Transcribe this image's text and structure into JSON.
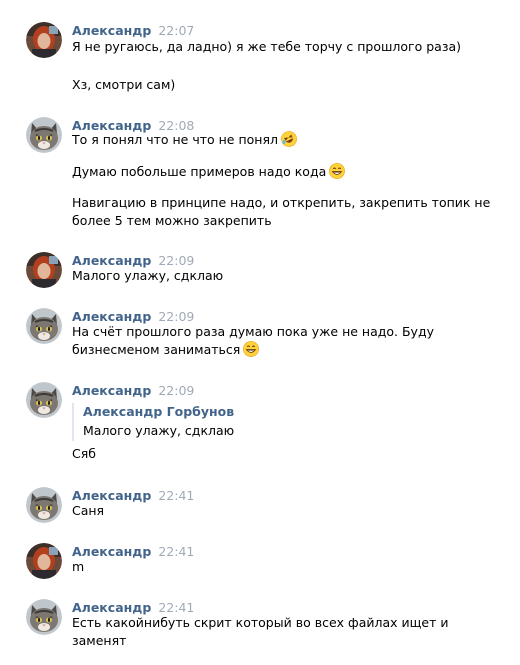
{
  "colors": {
    "author": "#42648b",
    "time": "#a0aab7",
    "quote_bar": "#dfe6ed"
  },
  "messages": [
    {
      "author": "Александр",
      "time": "22:07",
      "avatar": "red-hair-person-avatar",
      "lines": [
        "Я не ругаюсь, да ладно) я же тебе торчу с прошлого раза)",
        "Хз, смотри сам)"
      ]
    },
    {
      "author": "Александр",
      "time": "22:08",
      "avatar": "cat-avatar",
      "lines": [
        "То я понял что не что не понял",
        "Думаю побольше примеров надо кода",
        "Навигацию в принципе надо, и открепить, закрепить топик не",
        "более 5 тем можно закрепить"
      ],
      "emojis": [
        "rofl-emoji",
        "grin-emoji"
      ]
    },
    {
      "author": "Александр",
      "time": "22:09",
      "avatar": "red-hair-person-avatar",
      "lines": [
        "Малого улажу, сдклаю"
      ]
    },
    {
      "author": "Александр",
      "time": "22:09",
      "avatar": "cat-avatar",
      "lines": [
        "На счёт прошлого раза думаю пока уже не надо. Буду",
        "бизнесменом заниматься"
      ],
      "emojis": [
        "grin-emoji"
      ]
    },
    {
      "author": "Александр",
      "time": "22:09",
      "avatar": "cat-avatar",
      "quote": {
        "author": "Александр Горбунов",
        "text": "Малого улажу, сдклаю"
      },
      "lines": [
        "Сяб"
      ]
    },
    {
      "author": "Александр",
      "time": "22:41",
      "avatar": "cat-avatar",
      "lines": [
        "Саня"
      ]
    },
    {
      "author": "Александр",
      "time": "22:41",
      "avatar": "red-hair-person-avatar",
      "lines": [
        "m"
      ]
    },
    {
      "author": "Александр",
      "time": "22:41",
      "avatar": "cat-avatar",
      "lines": [
        "Есть какойнибуть скрит который во всех файлах ищет и",
        "заменят"
      ]
    }
  ]
}
